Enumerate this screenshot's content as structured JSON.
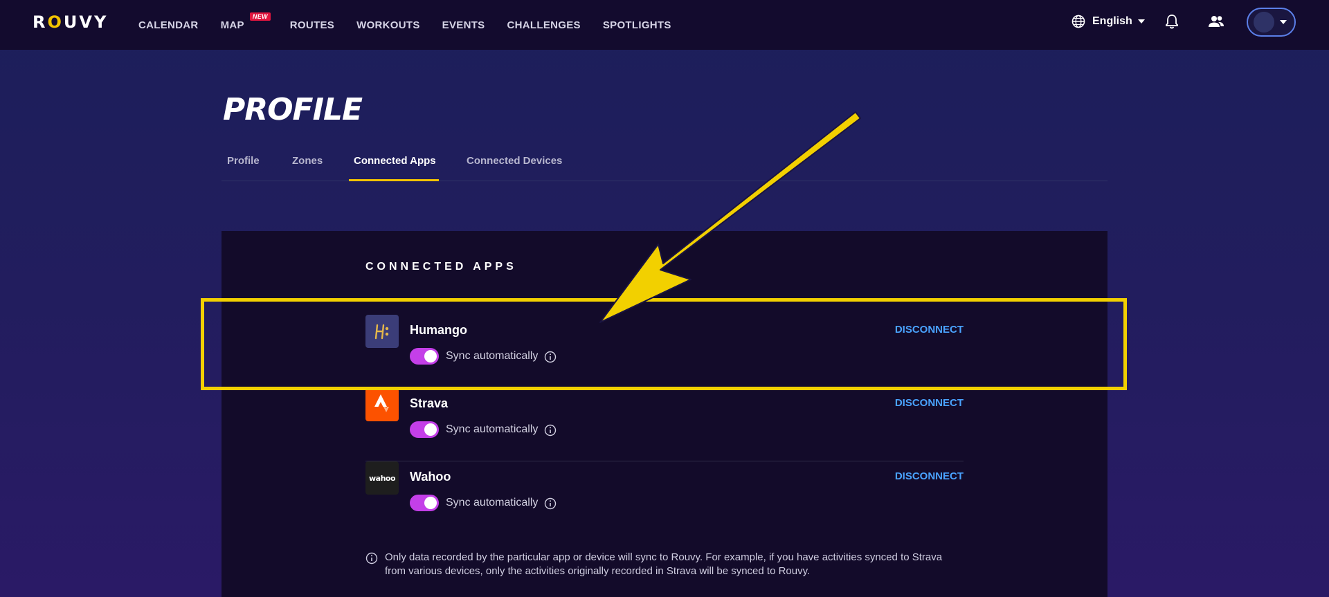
{
  "header": {
    "logo": {
      "pre": "R",
      "o": "O",
      "post": "UVY"
    },
    "nav": [
      {
        "label": "CALENDAR"
      },
      {
        "label": "MAP",
        "badge": "NEW"
      },
      {
        "label": "ROUTES"
      },
      {
        "label": "WORKOUTS"
      },
      {
        "label": "EVENTS"
      },
      {
        "label": "CHALLENGES"
      },
      {
        "label": "SPOTLIGHTS"
      }
    ],
    "language": "English",
    "icons": {
      "language": "globe-icon",
      "notifications": "bell-icon",
      "friends": "people-icon",
      "menu": "chevron-down-icon"
    }
  },
  "page": {
    "title": "PROFILE",
    "tabs": [
      {
        "label": "Profile"
      },
      {
        "label": "Zones"
      },
      {
        "label": "Connected Apps",
        "active": true
      },
      {
        "label": "Connected Devices"
      }
    ]
  },
  "connected_apps": {
    "section_title": "CONNECTED APPS",
    "items": [
      {
        "name": "Humango",
        "sync_label": "Sync automatically",
        "sync_on": true,
        "action": "DISCONNECT",
        "logo": "humango-logo",
        "logo_bg": "#3b3d78"
      },
      {
        "name": "Strava",
        "sync_label": "Sync automatically",
        "sync_on": true,
        "action": "DISCONNECT",
        "logo": "strava-logo",
        "logo_bg": "#fc5200"
      },
      {
        "name": "Wahoo",
        "sync_label": "Sync automatically",
        "sync_on": true,
        "action": "DISCONNECT",
        "logo": "wahoo-logo",
        "logo_text": "wahoo",
        "logo_bg": "#1e1e1e"
      }
    ],
    "footnote": "Only data recorded by the particular app or device will sync to Rouvy. For example, if you have activities synced to Strava from various devices, only the activities originally recorded in Strava will be synced to Rouvy."
  },
  "colors": {
    "accent_yellow": "#f2c300",
    "link_blue": "#4aa3ff",
    "toggle_on": "#c43fe8",
    "annotation": "#f2d000"
  }
}
